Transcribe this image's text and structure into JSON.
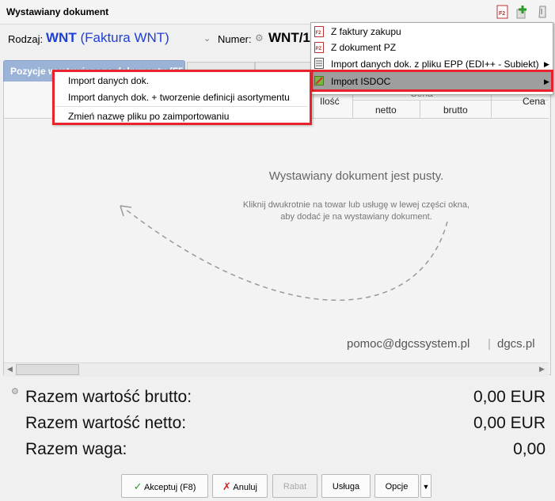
{
  "window": {
    "title": "Wystawiany dokument"
  },
  "header": {
    "rodzaj_label": "Rodzaj:",
    "rodzaj_code": "WNT",
    "rodzaj_name": "(Faktura WNT)",
    "numer_label": "Numer:",
    "numer_value": "WNT/1"
  },
  "tabs": {
    "active_label": "Pozycje wystawianego dokumentu (F5"
  },
  "grid": {
    "columns": {
      "ilosc": "Ilość",
      "cena": "Cena",
      "netto": "netto",
      "brutto": "brutto",
      "cena_right": "Cena"
    },
    "empty_title": "Wystawiany dokument jest pusty.",
    "empty_hint_line1": "Kliknij dwukrotnie na towar lub usługę w lewej części okna,",
    "empty_hint_line2": "aby dodać je na wystawiany dokument.",
    "contact_email": "pomoc@dgcssystem.pl",
    "contact_sep": "|",
    "contact_site": "dgcs.pl"
  },
  "totals": {
    "brutto_label": "Razem wartość brutto:",
    "brutto_value": "0,00 EUR",
    "netto_label": "Razem wartość netto:",
    "netto_value": "0,00 EUR",
    "waga_label": "Razem waga:",
    "waga_value": "0,00"
  },
  "buttons": {
    "accept": "Akceptuj (F8)",
    "cancel": "Anuluj",
    "rabat": "Rabat",
    "usluga": "Usługa",
    "opcje": "Opcje"
  },
  "import_menu": {
    "items": [
      "Z faktury zakupu",
      "Z dokument PZ",
      "Import danych dok. z pliku EPP (EDI++ - Subiekt)",
      "Import ISDOC"
    ]
  },
  "context_menu": {
    "items": [
      "Import danych dok.",
      "Import danych dok. + tworzenie definicji asortymentu",
      "Zmień nazwę pliku po zaimportowaniu"
    ]
  },
  "colors": {
    "accent_blue": "#1f3fd6",
    "highlight_red": "#e8232d",
    "tab_blue": "#9bb3d6"
  }
}
